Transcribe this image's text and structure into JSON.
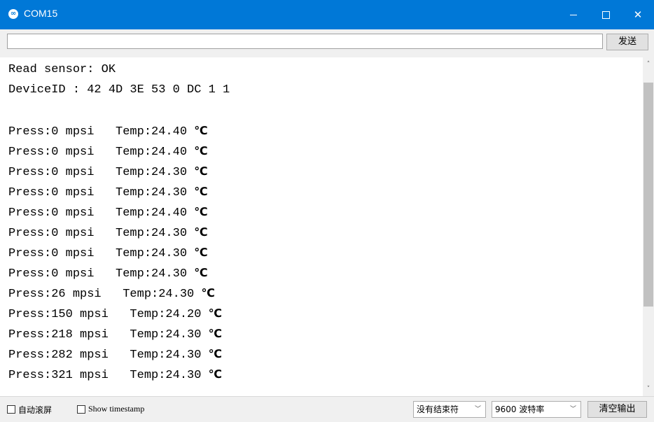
{
  "window": {
    "title": "COM15",
    "app_icon": "arduino-infinity-icon",
    "minimize_icon": "minimize-icon",
    "maximize_icon": "maximize-icon",
    "close_icon": "close-icon",
    "close_glyph": "✕",
    "titlebar_color": "#0078d7"
  },
  "send": {
    "input_value": "",
    "button_label": "发送"
  },
  "output": {
    "lines": [
      "Read sensor: OK",
      "DeviceID : 42 4D 3E 53 0 DC 1 1",
      "",
      "Press:0 mpsi   Temp:24.40 ",
      "Press:0 mpsi   Temp:24.40 ",
      "Press:0 mpsi   Temp:24.30 ",
      "Press:0 mpsi   Temp:24.30 ",
      "Press:0 mpsi   Temp:24.40 ",
      "Press:0 mpsi   Temp:24.30 ",
      "Press:0 mpsi   Temp:24.30 ",
      "Press:0 mpsi   Temp:24.30 ",
      "Press:26 mpsi   Temp:24.30 ",
      "Press:150 mpsi   Temp:24.20 ",
      "Press:218 mpsi   Temp:24.30 ",
      "Press:282 mpsi   Temp:24.30 ",
      "Press:321 mpsi   Temp:24.30 "
    ],
    "unit": "℃"
  },
  "scrollbar": {
    "up_icon": "scroll-up-icon",
    "down_icon": "scroll-down-icon",
    "up_glyph": "˄",
    "down_glyph": "˅"
  },
  "status": {
    "autoscroll_label": "自动滚屏",
    "autoscroll_checked": false,
    "timestamp_label": "Show timestamp",
    "timestamp_checked": false,
    "line_ending_value": "没有结束符",
    "baud_value": "9600 波特率",
    "clear_label": "清空输出",
    "dropdown_glyph": "﹀"
  }
}
